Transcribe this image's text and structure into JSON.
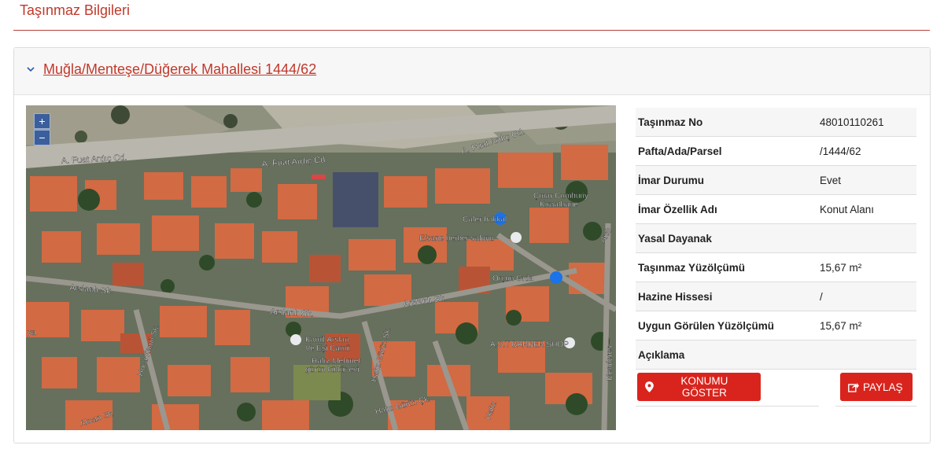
{
  "header": {
    "title": "Taşınmaz Bilgileri"
  },
  "panel": {
    "title": "Muğla/Menteşe/Düğerek Mahallesi 1444/62"
  },
  "map": {
    "zoom_in": "+",
    "zoom_out": "−",
    "labels": {
      "fuat_top": "A. Fuat Ardıç Cd.",
      "fuat_mid": "A. Fuat Ardıç Cd.",
      "fuat_left": "A. Fuat Ardıç Cd.",
      "cinar": "Çınar Cumhuriy",
      "kiraathane": "Kıraathane",
      "cafer": "Cafer bakkal",
      "efsane": "Efsane berber salonu",
      "orcun": "Orçun Gıda",
      "arslanli1": "Arslanlı Sk.",
      "arslanli2": "Arslanlı Sk.",
      "arslanli3": "Arslanlı Sk.",
      "kamil": "Kamil Arslan",
      "cami": "Ve Eşi Camii",
      "hafiz": "Hafız Mehmet",
      "gurun_kultur": "gürün kültür evi",
      "ast": "A.S.T BARBER SHOP",
      "hafiz_gurun_sk": "Hafız Gürün Sk.",
      "hafiz_gurun_ck": "Hafız Gürün Çk.",
      "hafiz_vertical": "Hafız",
      "akcan": "Akcan Sk.",
      "hoca": "Hoca Kamil Sk.",
      "menderes": "Menderes",
      "arsl_right": "Arslı",
      "ya": "ya"
    }
  },
  "info": {
    "rows": [
      {
        "label": "Taşınmaz No",
        "value": "48010110261"
      },
      {
        "label": "Pafta/Ada/Parsel",
        "value": "/1444/62"
      },
      {
        "label": "İmar Durumu",
        "value": "Evet"
      },
      {
        "label": "İmar Özellik Adı",
        "value": "Konut Alanı"
      },
      {
        "label": "Yasal Dayanak",
        "value": ""
      },
      {
        "label": "Taşınmaz Yüzölçümü",
        "value": "15,67 m²"
      },
      {
        "label": "Hazine Hissesi",
        "value": "/"
      },
      {
        "label": "Uygun Görülen Yüzölçümü",
        "value": "15,67 m²"
      },
      {
        "label": "Açıklama",
        "value": ""
      }
    ]
  },
  "buttons": {
    "locate": "KONUMU GÖSTER",
    "share": "PAYLAŞ"
  },
  "colors": {
    "accent": "#c0392b",
    "button": "#d9241d",
    "zoom": "#3b5f9c"
  },
  "icons": {
    "chevron": "chevron-down-icon",
    "locate": "map-marker-icon",
    "share": "share-icon"
  }
}
